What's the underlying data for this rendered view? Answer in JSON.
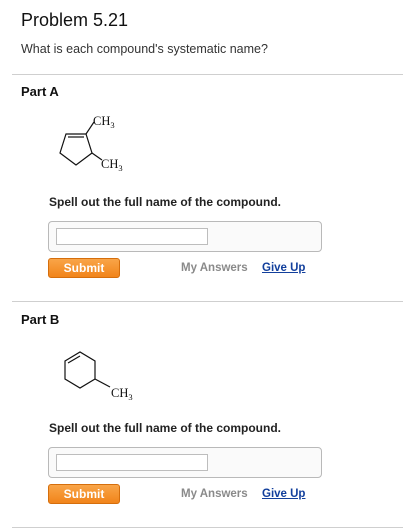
{
  "problem": {
    "title": "Problem 5.21",
    "question": "What is each compound's systematic name?"
  },
  "parts": [
    {
      "label": "Part A",
      "molecule": {
        "substituent_1": "CH",
        "substituent_1_sub": "3",
        "substituent_2": "CH",
        "substituent_2_sub": "3"
      },
      "instruction": "Spell out the full name of the compound.",
      "answer_value": "",
      "submit_label": "Submit",
      "my_answers_label": "My Answers",
      "give_up_label": "Give Up"
    },
    {
      "label": "Part B",
      "molecule": {
        "substituent_1": "CH",
        "substituent_1_sub": "3"
      },
      "instruction": "Spell out the full name of the compound.",
      "answer_value": "",
      "submit_label": "Submit",
      "my_answers_label": "My Answers",
      "give_up_label": "Give Up"
    }
  ],
  "colors": {
    "submit_button": "#f1841a",
    "give_up_link": "#123f9c",
    "my_answers_text": "#8a8a8a",
    "divider": "#cfcfcf"
  }
}
